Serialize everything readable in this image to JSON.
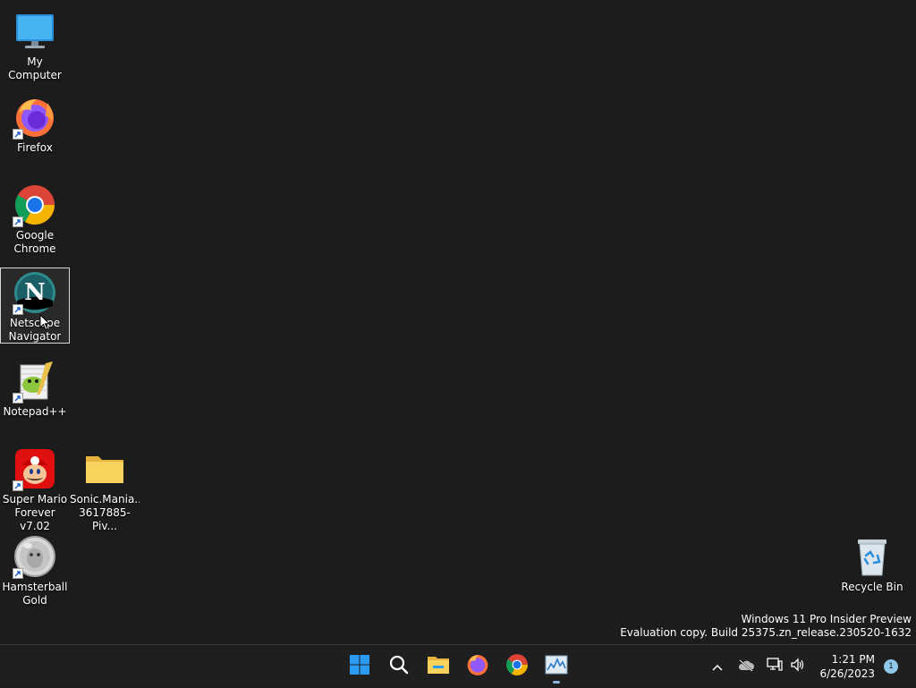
{
  "desktop": {
    "icons": [
      {
        "label": "My Computer",
        "icon": "monitor-icon"
      },
      {
        "label": "Firefox",
        "icon": "firefox-icon"
      },
      {
        "label": "Google\nChrome",
        "icon": "chrome-icon"
      },
      {
        "label": "Netscape\nNavigator",
        "icon": "netscape-icon",
        "letter": "N"
      },
      {
        "label": "Notepad++",
        "icon": "notepad-plus-plus-icon"
      },
      {
        "label": "Super Mario\nForever v7.02",
        "icon": "mario-icon"
      },
      {
        "label": "Sonic.Mania...\n3617885-Piv...",
        "icon": "folder-icon"
      },
      {
        "label": "Hamsterball\nGold",
        "icon": "hamsterball-icon"
      },
      {
        "label": "Recycle Bin",
        "icon": "recycle-bin-icon"
      }
    ],
    "watermark": {
      "line1": "Windows 11 Pro Insider Preview",
      "line2": "Evaluation copy. Build 25375.zn_release.230520-1632"
    }
  },
  "taskbar": {
    "apps": [
      {
        "icon": "start-icon"
      },
      {
        "icon": "search-icon"
      },
      {
        "icon": "file-explorer-icon"
      },
      {
        "icon": "firefox-icon"
      },
      {
        "icon": "chrome-icon"
      },
      {
        "icon": "task-manager-icon"
      }
    ],
    "tray": {
      "time": "1:21 PM",
      "date": "6/26/2023",
      "notification_count": "1"
    }
  },
  "colors": {
    "desktop_bg": "#1c1c1c",
    "taskbar_bg": "#1f1f1f",
    "windows_blue": "#0078d4",
    "folder_yellow": "#f8d25c"
  }
}
